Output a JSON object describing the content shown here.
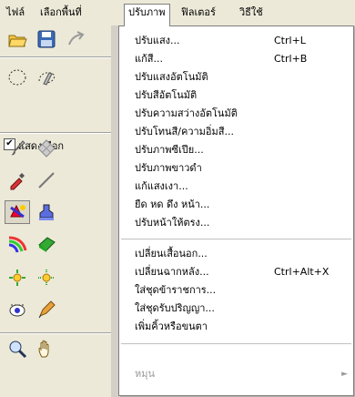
{
  "menubar": {
    "items": [
      {
        "label": "ไฟล์"
      },
      {
        "label": "เลือกพื้นที่"
      },
      {
        "label": "ปรับภาพ"
      },
      {
        "label": "ฟิลเตอร์"
      },
      {
        "label": "วิธีใช้"
      }
    ]
  },
  "toolbox": {
    "show_selection_label": "แสดงเลือก",
    "show_selection_checked": "✔",
    "tools": [
      "open-icon",
      "save-icon",
      "link-icon",
      "ellipse-select-icon",
      "lasso-icon",
      "brush-icon",
      "pattern-icon",
      "eyedropper-icon",
      "line-icon",
      "effects-icon",
      "stamp-icon",
      "gradient-icon",
      "eraser-icon",
      "sparkle-icon",
      "sparkle-alt-icon",
      "redeye-icon",
      "pencil-icon",
      "zoom-icon",
      "hand-icon"
    ]
  },
  "menu": {
    "items": [
      {
        "label": "ปรับแสง...",
        "shortcut": "Ctrl+L"
      },
      {
        "label": "แก้สี...",
        "shortcut": "Ctrl+B"
      },
      {
        "label": "ปรับแสงอัตโนมัติ",
        "shortcut": ""
      },
      {
        "label": "ปรับสีอัตโนมัติ",
        "shortcut": ""
      },
      {
        "label": "ปรับความสว่างอัตโนมัติ",
        "shortcut": ""
      },
      {
        "label": "ปรับโทนสี/ความอิ่มสี...",
        "shortcut": ""
      },
      {
        "label": "ปรับภาพซีเปีย...",
        "shortcut": ""
      },
      {
        "label": "ปรับภาพขาวดำ",
        "shortcut": ""
      },
      {
        "label": "แก้แสงเงา...",
        "shortcut": ""
      },
      {
        "label": "ยืด หด ดึง หน้า...",
        "shortcut": ""
      },
      {
        "label": "ปรับหน้าให้ตรง...",
        "shortcut": ""
      },
      {
        "label": "เปลี่ยนเสื้อนอก...",
        "shortcut": ""
      },
      {
        "label": "เปลี่ยนฉากหลัง...",
        "shortcut": "Ctrl+Alt+X"
      },
      {
        "label": "ใส่ชุดข้าราชการ...",
        "shortcut": ""
      },
      {
        "label": "ใส่ชุดรับปริญญา...",
        "shortcut": ""
      },
      {
        "label": "เพิ่มคิ้วหรือขนตา",
        "shortcut": ""
      },
      {
        "label": "หมุน",
        "shortcut": ""
      }
    ]
  }
}
